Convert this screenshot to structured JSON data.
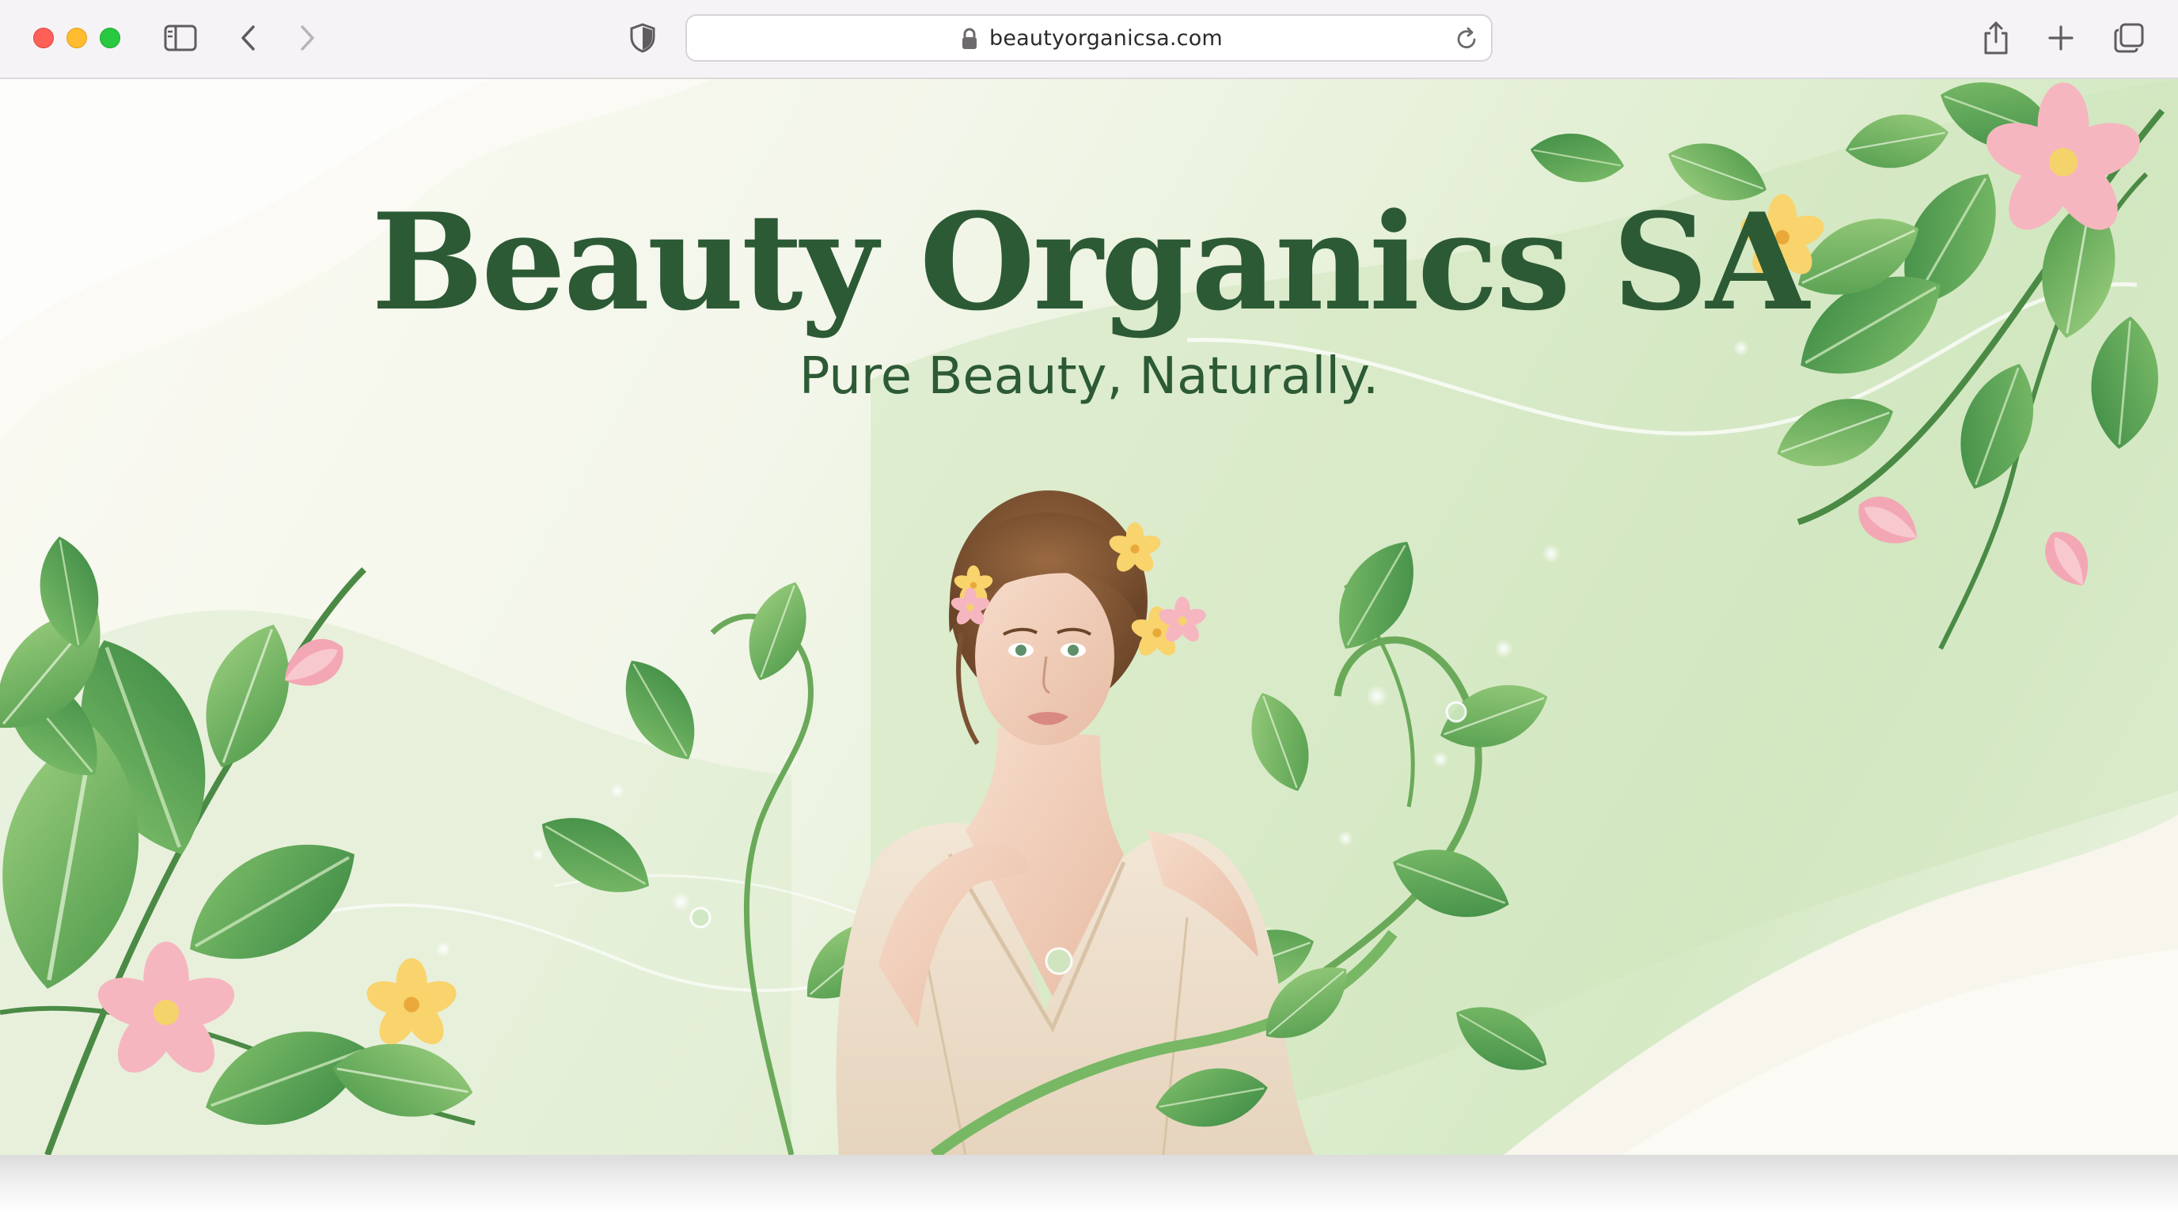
{
  "browser": {
    "url": "beautyorganicsa.com",
    "toolbar_icons": [
      "sidebar-icon",
      "back-icon",
      "forward-icon",
      "shield-icon",
      "lock-icon",
      "reload-icon",
      "share-icon",
      "new-tab-icon",
      "tabs-overview-icon"
    ]
  },
  "hero": {
    "title": "Beauty Organics SA",
    "tagline": "Pure Beauty, Naturally.",
    "image": "woman-with-flowers-and-vines"
  },
  "colors": {
    "brand_green": "#2c5a35",
    "leaf_green": "#4f9a4b",
    "blossom_pink": "#f3a7b4",
    "blossom_yellow": "#f9d36b",
    "background_cream": "#f8f7ee"
  }
}
